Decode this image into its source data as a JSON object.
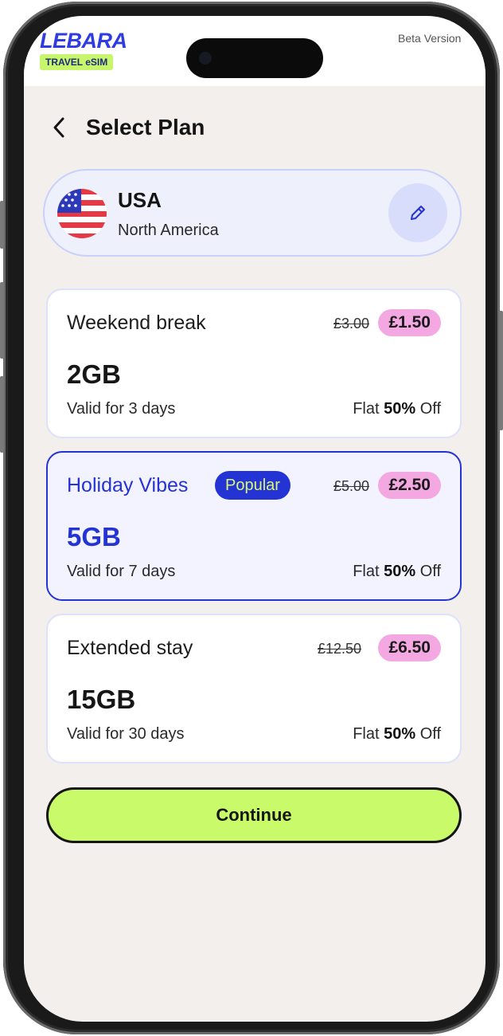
{
  "brand": {
    "name": "LEBARA",
    "badge": "TRAVEL eSIM"
  },
  "status": {
    "beta_label": "Beta Version"
  },
  "header": {
    "title": "Select Plan"
  },
  "destination": {
    "country": "USA",
    "region": "North America"
  },
  "plans": [
    {
      "name": "Weekend break",
      "old_price": "£3.00",
      "price": "£1.50",
      "data": "2GB",
      "validity": "Valid for 3 days",
      "off_prefix": "Flat",
      "off_value": "50%",
      "off_suffix": "Off",
      "selected": false
    },
    {
      "name": "Holiday Vibes",
      "badge": "Popular",
      "old_price": "£5.00",
      "price": "£2.50",
      "data": "5GB",
      "validity": "Valid for 7 days",
      "off_prefix": "Flat",
      "off_value": "50%",
      "off_suffix": "Off",
      "selected": true
    },
    {
      "name": "Extended stay",
      "old_price": "£12.50",
      "price": "£6.50",
      "data": "15GB",
      "validity": "Valid for 30 days",
      "off_prefix": "Flat",
      "off_value": "50%",
      "off_suffix": "Off",
      "selected": false
    }
  ],
  "actions": {
    "continue_label": "Continue"
  },
  "icons": {
    "back": "chevron-left-icon",
    "edit": "pencil-icon",
    "flag": "us-flag-icon"
  },
  "colors": {
    "brand_blue": "#2433d4",
    "accent_green": "#c9fa6a",
    "price_pink": "#f4a8e2",
    "background": "#f2efec"
  }
}
